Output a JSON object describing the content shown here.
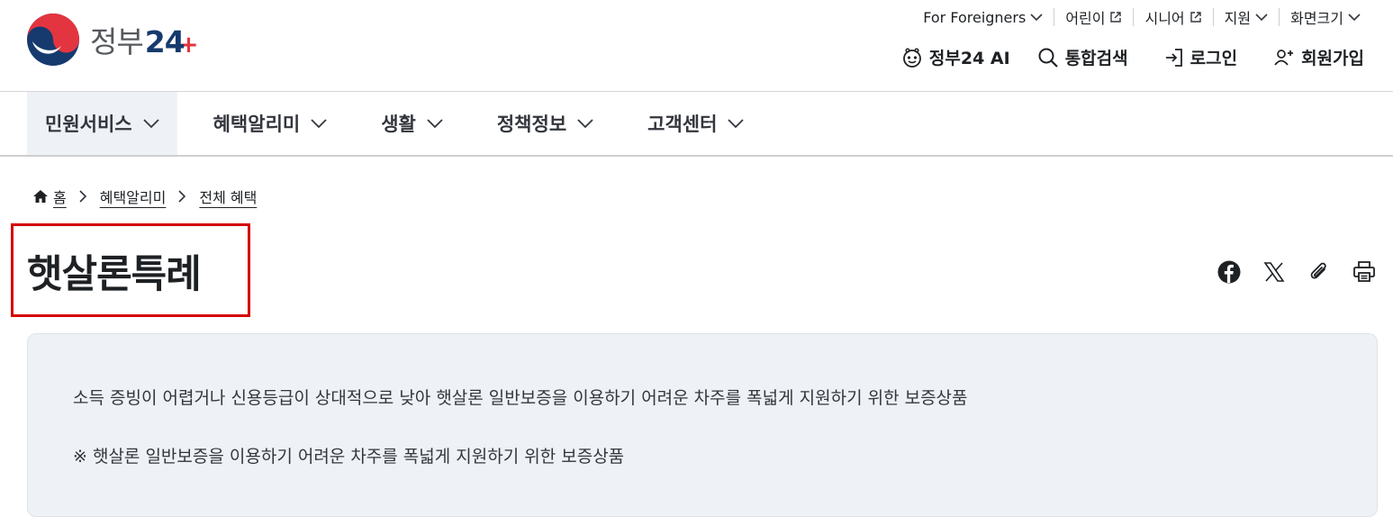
{
  "logo": {
    "text": "정부",
    "num": "24",
    "plus": "+"
  },
  "util_links": [
    {
      "label": "For Foreigners",
      "icon": "chevron-down-icon"
    },
    {
      "label": "어린이",
      "icon": "external-link-icon"
    },
    {
      "label": "시니어",
      "icon": "external-link-icon"
    },
    {
      "label": "지원",
      "icon": "chevron-down-icon"
    },
    {
      "label": "화면크기",
      "icon": "chevron-down-icon"
    }
  ],
  "gnb": {
    "ai": "정부24 AI",
    "search": "통합검색",
    "login": "로그인",
    "signup": "회원가입"
  },
  "menu": [
    {
      "label": "민원서비스",
      "active": true
    },
    {
      "label": "혜택알리미",
      "active": false
    },
    {
      "label": "생활",
      "active": false
    },
    {
      "label": "정책정보",
      "active": false
    },
    {
      "label": "고객센터",
      "active": false
    }
  ],
  "breadcrumb": {
    "home": "홈",
    "level1": "혜택알리미",
    "level2": "전체 혜택"
  },
  "page_title": "햇살론특례",
  "share_buttons": [
    "facebook-icon",
    "x-icon",
    "clip-icon",
    "print-icon"
  ],
  "summary": {
    "line1": "소득 증빙이 어렵거나 신용등급이 상대적으로 낮아 햇살론 일반보증을 이용하기 어려운 차주를 폭넓게 지원하기 위한 보증상품",
    "line2": "※ 햇살론 일반보증을 이용하기 어려운 차주를 폭넓게 지원하기 위한 보증상품"
  },
  "colors": {
    "brand_navy": "#163a6e",
    "brand_red": "#e3353f",
    "highlight_box": "#d40000",
    "summary_bg": "#eef1f5"
  }
}
